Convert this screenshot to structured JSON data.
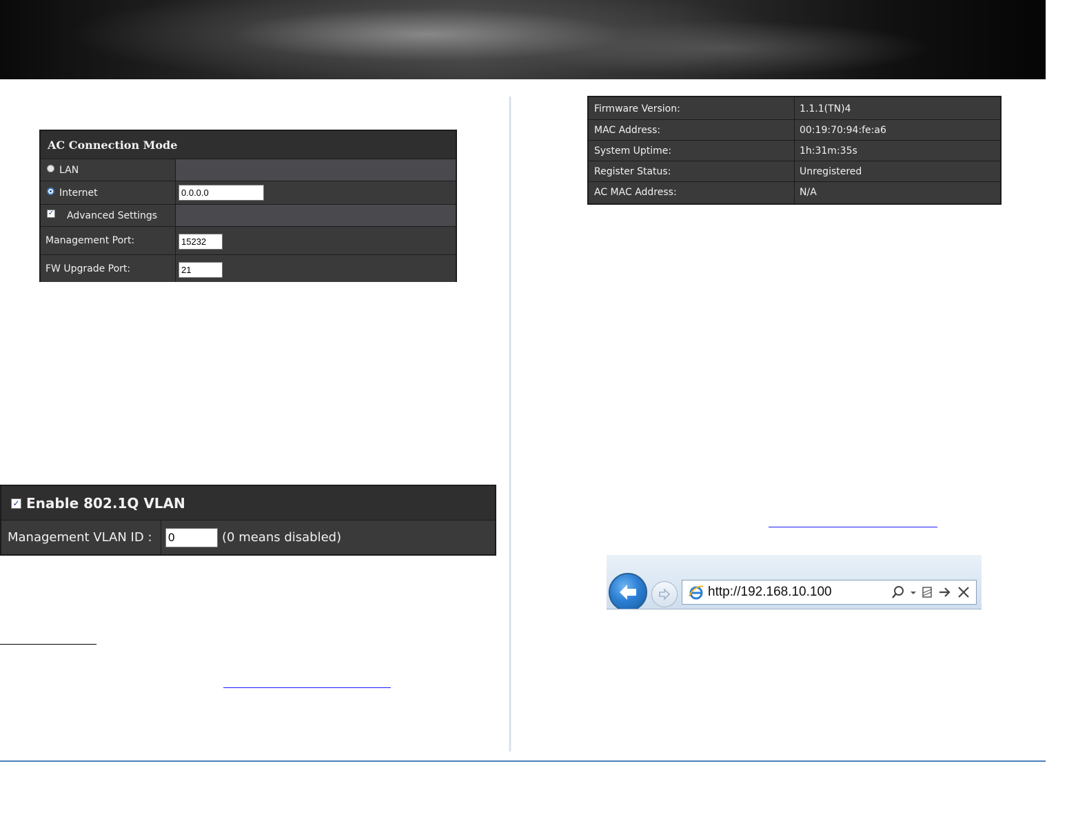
{
  "ac_panel": {
    "title": "AC Connection Mode",
    "lan_label": "LAN",
    "internet_label": "Internet",
    "internet_value": "0.0.0.0",
    "advanced_label": "Advanced Settings",
    "mgmt_port_label": "Management Port:",
    "mgmt_port_value": "15232",
    "fw_port_label": "FW Upgrade Port:",
    "fw_port_value": "21"
  },
  "vlan_panel": {
    "title": "Enable 802.1Q VLAN",
    "vlan_id_label": "Management VLAN ID :",
    "vlan_id_value": "0",
    "vlan_hint": "(0 means disabled)"
  },
  "status_panel": {
    "rows": [
      {
        "label": "Firmware Version:",
        "value": "1.1.1(TN)4"
      },
      {
        "label": "MAC Address:",
        "value": "00:19:70:94:fe:a6"
      },
      {
        "label": "System Uptime:",
        "value": "1h:31m:35s"
      },
      {
        "label": "Register Status:",
        "value": "Unregistered"
      },
      {
        "label": "AC MAC Address:",
        "value": "N/A"
      }
    ]
  },
  "browser": {
    "url": "http://192.168.10.100"
  }
}
